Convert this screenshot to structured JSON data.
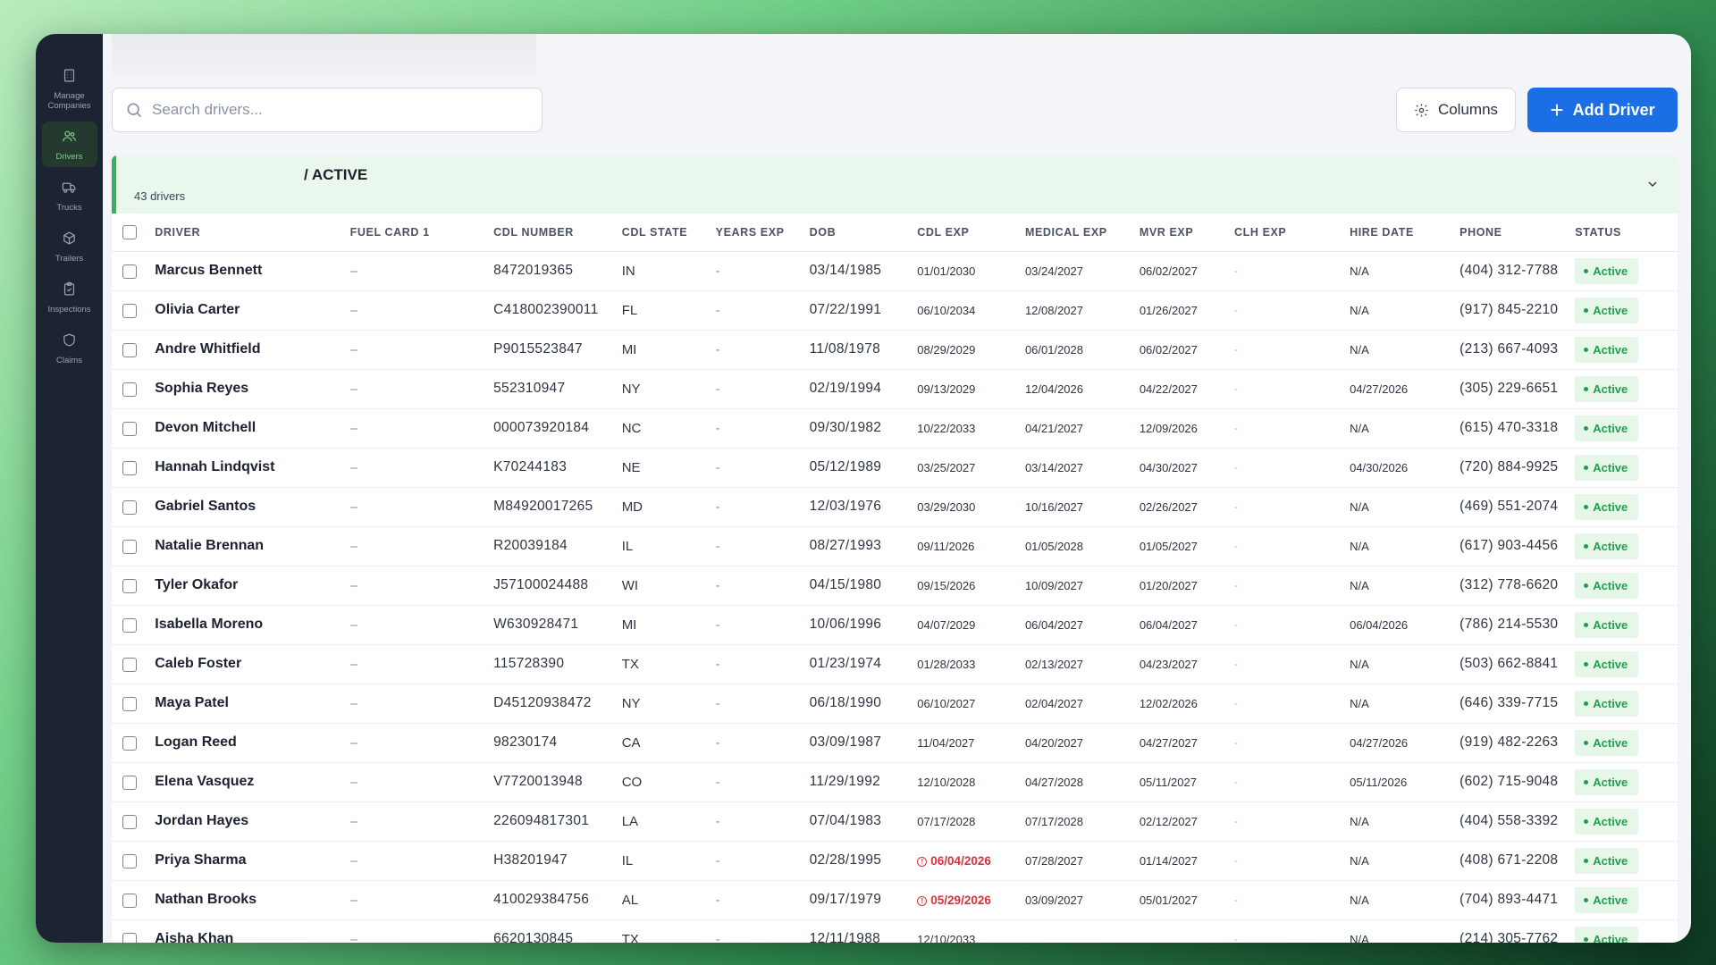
{
  "sidebar": {
    "items": [
      {
        "label": "Manage Companies",
        "icon": "building-icon",
        "active": false
      },
      {
        "label": "Drivers",
        "icon": "users-icon",
        "active": true
      },
      {
        "label": "Trucks",
        "icon": "truck-icon",
        "active": false
      },
      {
        "label": "Trailers",
        "icon": "trailer-icon",
        "active": false
      },
      {
        "label": "Inspections",
        "icon": "clipboard-icon",
        "active": false
      },
      {
        "label": "Claims",
        "icon": "shield-icon",
        "active": false
      }
    ]
  },
  "search": {
    "placeholder": "Search drivers..."
  },
  "toolbar": {
    "columns_label": "Columns",
    "add_label": "Add Driver"
  },
  "group": {
    "title": "/ ACTIVE",
    "count": "43 drivers"
  },
  "columns": [
    "DRIVER",
    "FUEL CARD 1",
    "CDL NUMBER",
    "CDL STATE",
    "YEARS EXP",
    "DOB",
    "CDL EXP",
    "MEDICAL EXP",
    "MVR EXP",
    "CLH EXP",
    "HIRE DATE",
    "PHONE",
    "STATUS"
  ],
  "colors": {
    "accent": "#1b6ee3",
    "active_green": "#22a04a",
    "warning_red": "#d5323a",
    "sidebar_bg": "#1c2433"
  },
  "rows": [
    {
      "driver": "Marcus Bennett",
      "fuel": "–",
      "cdl": "8472019365",
      "state": "IN",
      "years": "-",
      "dob": "03/14/1985",
      "cdl_exp": "01/01/2030",
      "cdl_warn": false,
      "med": "03/24/2027",
      "mvr": "06/02/2027",
      "clh": "-",
      "hire": "N/A",
      "phone": "(404) 312-7788",
      "status": "Active"
    },
    {
      "driver": "Olivia Carter",
      "fuel": "–",
      "cdl": "C418002390011",
      "state": "FL",
      "years": "-",
      "dob": "07/22/1991",
      "cdl_exp": "06/10/2034",
      "cdl_warn": false,
      "med": "12/08/2027",
      "mvr": "01/26/2027",
      "clh": "-",
      "hire": "N/A",
      "phone": "(917) 845-2210",
      "status": "Active"
    },
    {
      "driver": "Andre Whitfield",
      "fuel": "–",
      "cdl": "P9015523847",
      "state": "MI",
      "years": "-",
      "dob": "11/08/1978",
      "cdl_exp": "08/29/2029",
      "cdl_warn": false,
      "med": "06/01/2028",
      "mvr": "06/02/2027",
      "clh": "-",
      "hire": "N/A",
      "phone": "(213) 667-4093",
      "status": "Active"
    },
    {
      "driver": "Sophia Reyes",
      "fuel": "–",
      "cdl": "552310947",
      "state": "NY",
      "years": "-",
      "dob": "02/19/1994",
      "cdl_exp": "09/13/2029",
      "cdl_warn": false,
      "med": "12/04/2026",
      "mvr": "04/22/2027",
      "clh": "-",
      "hire": "04/27/2026",
      "phone": "(305) 229-6651",
      "status": "Active"
    },
    {
      "driver": "Devon Mitchell",
      "fuel": "–",
      "cdl": "000073920184",
      "state": "NC",
      "years": "-",
      "dob": "09/30/1982",
      "cdl_exp": "10/22/2033",
      "cdl_warn": false,
      "med": "04/21/2027",
      "mvr": "12/09/2026",
      "clh": "-",
      "hire": "N/A",
      "phone": "(615) 470-3318",
      "status": "Active"
    },
    {
      "driver": "Hannah Lindqvist",
      "fuel": "–",
      "cdl": "K70244183",
      "state": "NE",
      "years": "-",
      "dob": "05/12/1989",
      "cdl_exp": "03/25/2027",
      "cdl_warn": false,
      "med": "03/14/2027",
      "mvr": "04/30/2027",
      "clh": "-",
      "hire": "04/30/2026",
      "phone": "(720) 884-9925",
      "status": "Active"
    },
    {
      "driver": "Gabriel Santos",
      "fuel": "–",
      "cdl": "M84920017265",
      "state": "MD",
      "years": "-",
      "dob": "12/03/1976",
      "cdl_exp": "03/29/2030",
      "cdl_warn": false,
      "med": "10/16/2027",
      "mvr": "02/26/2027",
      "clh": "-",
      "hire": "N/A",
      "phone": "(469) 551-2074",
      "status": "Active"
    },
    {
      "driver": "Natalie Brennan",
      "fuel": "–",
      "cdl": "R20039184",
      "state": "IL",
      "years": "-",
      "dob": "08/27/1993",
      "cdl_exp": "09/11/2026",
      "cdl_warn": false,
      "med": "01/05/2028",
      "mvr": "01/05/2027",
      "clh": "-",
      "hire": "N/A",
      "phone": "(617) 903-4456",
      "status": "Active"
    },
    {
      "driver": "Tyler Okafor",
      "fuel": "–",
      "cdl": "J57100024488",
      "state": "WI",
      "years": "-",
      "dob": "04/15/1980",
      "cdl_exp": "09/15/2026",
      "cdl_warn": false,
      "med": "10/09/2027",
      "mvr": "01/20/2027",
      "clh": "-",
      "hire": "N/A",
      "phone": "(312) 778-6620",
      "status": "Active"
    },
    {
      "driver": "Isabella Moreno",
      "fuel": "–",
      "cdl": "W630928471",
      "state": "MI",
      "years": "-",
      "dob": "10/06/1996",
      "cdl_exp": "04/07/2029",
      "cdl_warn": false,
      "med": "06/04/2027",
      "mvr": "06/04/2027",
      "clh": "-",
      "hire": "06/04/2026",
      "phone": "(786) 214-5530",
      "status": "Active"
    },
    {
      "driver": "Caleb Foster",
      "fuel": "–",
      "cdl": "115728390",
      "state": "TX",
      "years": "-",
      "dob": "01/23/1974",
      "cdl_exp": "01/28/2033",
      "cdl_warn": false,
      "med": "02/13/2027",
      "mvr": "04/23/2027",
      "clh": "-",
      "hire": "N/A",
      "phone": "(503) 662-8841",
      "status": "Active"
    },
    {
      "driver": "Maya Patel",
      "fuel": "–",
      "cdl": "D45120938472",
      "state": "NY",
      "years": "-",
      "dob": "06/18/1990",
      "cdl_exp": "06/10/2027",
      "cdl_warn": false,
      "med": "02/04/2027",
      "mvr": "12/02/2026",
      "clh": "-",
      "hire": "N/A",
      "phone": "(646) 339-7715",
      "status": "Active"
    },
    {
      "driver": "Logan Reed",
      "fuel": "–",
      "cdl": "98230174",
      "state": "CA",
      "years": "-",
      "dob": "03/09/1987",
      "cdl_exp": "11/04/2027",
      "cdl_warn": false,
      "med": "04/20/2027",
      "mvr": "04/27/2027",
      "clh": "-",
      "hire": "04/27/2026",
      "phone": "(919) 482-2263",
      "status": "Active"
    },
    {
      "driver": "Elena Vasquez",
      "fuel": "–",
      "cdl": "V7720013948",
      "state": "CO",
      "years": "-",
      "dob": "11/29/1992",
      "cdl_exp": "12/10/2028",
      "cdl_warn": false,
      "med": "04/27/2028",
      "mvr": "05/11/2027",
      "clh": "-",
      "hire": "05/11/2026",
      "phone": "(602) 715-9048",
      "status": "Active"
    },
    {
      "driver": "Jordan Hayes",
      "fuel": "–",
      "cdl": "226094817301",
      "state": "LA",
      "years": "-",
      "dob": "07/04/1983",
      "cdl_exp": "07/17/2028",
      "cdl_warn": false,
      "med": "07/17/2028",
      "mvr": "02/12/2027",
      "clh": "-",
      "hire": "N/A",
      "phone": "(404) 558-3392",
      "status": "Active"
    },
    {
      "driver": "Priya Sharma",
      "fuel": "–",
      "cdl": "H38201947",
      "state": "IL",
      "years": "-",
      "dob": "02/28/1995",
      "cdl_exp": "06/04/2026",
      "cdl_warn": true,
      "med": "07/28/2027",
      "mvr": "01/14/2027",
      "clh": "-",
      "hire": "N/A",
      "phone": "(408) 671-2208",
      "status": "Active"
    },
    {
      "driver": "Nathan Brooks",
      "fuel": "–",
      "cdl": "410029384756",
      "state": "AL",
      "years": "-",
      "dob": "09/17/1979",
      "cdl_exp": "05/29/2026",
      "cdl_warn": true,
      "med": "03/09/2027",
      "mvr": "05/01/2027",
      "clh": "-",
      "hire": "N/A",
      "phone": "(704) 893-4471",
      "status": "Active"
    },
    {
      "driver": "Aisha Khan",
      "fuel": "–",
      "cdl": "6620130845",
      "state": "TX",
      "years": "-",
      "dob": "12/11/1988",
      "cdl_exp": "12/10/2033",
      "cdl_warn": false,
      "med": "",
      "mvr": "",
      "clh": "-",
      "hire": "N/A",
      "phone": "(214) 305-7762",
      "status": "Active"
    }
  ]
}
